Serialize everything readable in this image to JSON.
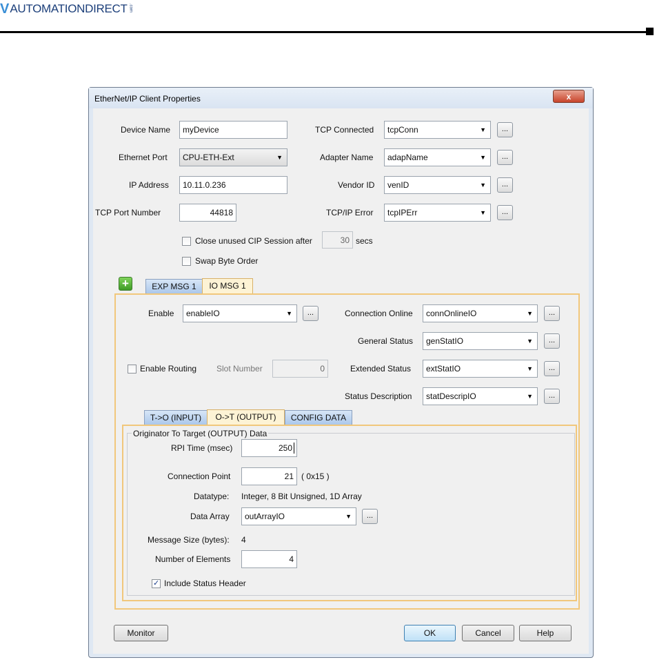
{
  "header": {
    "logo_text": "AUTOMATIONDIRECT",
    "logo_suffix": ".com"
  },
  "dialog": {
    "title": "EtherNet/IP Client Properties",
    "close_label": "x",
    "device_name": {
      "label": "Device Name",
      "value": "myDevice"
    },
    "ethernet_port": {
      "label": "Ethernet Port",
      "value": "CPU-ETH-Ext"
    },
    "ip_address": {
      "label": "IP Address",
      "value": "10.11.0.236"
    },
    "tcp_port": {
      "label": "TCP Port Number",
      "value": "44818"
    },
    "tcp_connected": {
      "label": "TCP Connected",
      "value": "tcpConn"
    },
    "adapter_name": {
      "label": "Adapter Name",
      "value": "adapName"
    },
    "vendor_id": {
      "label": "Vendor ID",
      "value": "venID"
    },
    "tcpip_error": {
      "label": "TCP/IP Error",
      "value": "tcpIPErr"
    },
    "close_unused": {
      "label": "Close unused CIP Session after",
      "value": "30",
      "unit": "secs",
      "checked": false
    },
    "swap_byte": {
      "label": "Swap Byte Order",
      "checked": false
    },
    "dots_label": "...",
    "msg_tabs": [
      {
        "label": "EXP MSG 1"
      },
      {
        "label": "IO MSG 1"
      }
    ],
    "io": {
      "enable": {
        "label": "Enable",
        "value": "enableIO"
      },
      "enable_routing": {
        "label": "Enable Routing",
        "checked": false
      },
      "slot_number": {
        "label": "Slot Number",
        "value": "0"
      },
      "connection_online": {
        "label": "Connection Online",
        "value": "connOnlineIO"
      },
      "general_status": {
        "label": "General Status",
        "value": "genStatIO"
      },
      "extended_status": {
        "label": "Extended Status",
        "value": "extStatIO"
      },
      "status_description": {
        "label": "Status Description",
        "value": "statDescripIO"
      },
      "sub_tabs": [
        {
          "label": "T->O (INPUT)"
        },
        {
          "label": "O->T (OUTPUT)"
        },
        {
          "label": "CONFIG DATA"
        }
      ],
      "output": {
        "group_title": "Originator To Target (OUTPUT) Data",
        "rpi": {
          "label": "RPI Time (msec)",
          "value": "250"
        },
        "connection_point": {
          "label": "Connection Point",
          "value": "21",
          "hex": "( 0x15 )"
        },
        "datatype": {
          "label": "Datatype:",
          "value": "Integer, 8 Bit Unsigned, 1D Array"
        },
        "data_array": {
          "label": "Data Array",
          "value": "outArrayIO"
        },
        "message_size": {
          "label": "Message Size (bytes):",
          "value": "4"
        },
        "num_elements": {
          "label": "Number of Elements",
          "value": "4"
        },
        "include_status": {
          "label": "Include Status Header",
          "checked": true
        }
      }
    },
    "buttons": {
      "monitor": "Monitor",
      "ok": "OK",
      "cancel": "Cancel",
      "help": "Help"
    }
  }
}
